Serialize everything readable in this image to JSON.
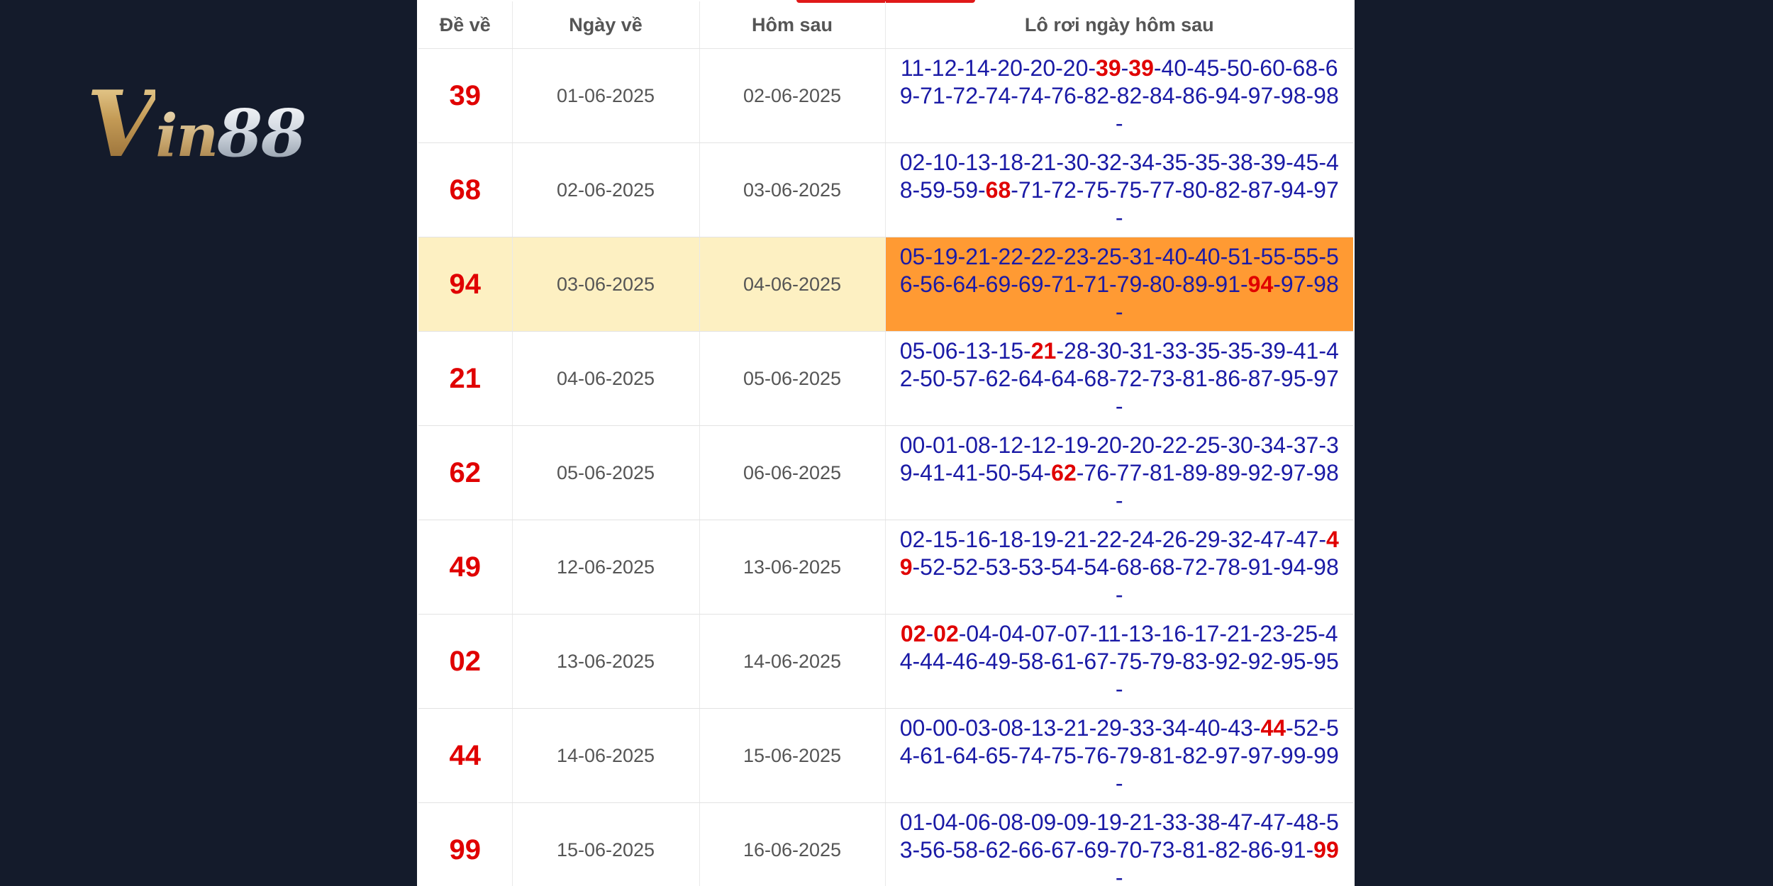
{
  "brand": {
    "logo_v": "V",
    "logo_in": "in",
    "logo_num": "88"
  },
  "table": {
    "headers": [
      "Đề về",
      "Ngày về",
      "Hôm sau",
      "Lô rơi ngày hôm sau"
    ],
    "rows": [
      {
        "de": "39",
        "ngay_ve": "01-06-2025",
        "hom_sau": "02-06-2025",
        "lo": "11-12-14-20-20-20-39-39-40-45-50-60-68-69-71-72-74-74-76-82-82-84-86-94-97-98-98-",
        "highlight": false
      },
      {
        "de": "68",
        "ngay_ve": "02-06-2025",
        "hom_sau": "03-06-2025",
        "lo": "02-10-13-18-21-30-32-34-35-35-38-39-45-48-59-59-68-71-72-75-75-77-80-82-87-94-97-",
        "highlight": false
      },
      {
        "de": "94",
        "ngay_ve": "03-06-2025",
        "hom_sau": "04-06-2025",
        "lo": "05-19-21-22-22-23-25-31-40-40-51-55-55-56-56-64-69-69-71-71-79-80-89-91-94-97-98-",
        "highlight": true
      },
      {
        "de": "21",
        "ngay_ve": "04-06-2025",
        "hom_sau": "05-06-2025",
        "lo": "05-06-13-15-21-28-30-31-33-35-35-39-41-42-50-57-62-64-64-68-72-73-81-86-87-95-97-",
        "highlight": false
      },
      {
        "de": "62",
        "ngay_ve": "05-06-2025",
        "hom_sau": "06-06-2025",
        "lo": "00-01-08-12-12-19-20-20-22-25-30-34-37-39-41-41-50-54-62-76-77-81-89-89-92-97-98-",
        "highlight": false
      },
      {
        "de": "49",
        "ngay_ve": "12-06-2025",
        "hom_sau": "13-06-2025",
        "lo": "02-15-16-18-19-21-22-24-26-29-32-47-47-49-52-52-53-53-54-54-68-68-72-78-91-94-98-",
        "highlight": false
      },
      {
        "de": "02",
        "ngay_ve": "13-06-2025",
        "hom_sau": "14-06-2025",
        "lo": "02-02-04-04-07-07-11-13-16-17-21-23-25-44-44-46-49-58-61-67-75-79-83-92-92-95-95-",
        "highlight": false
      },
      {
        "de": "44",
        "ngay_ve": "14-06-2025",
        "hom_sau": "15-06-2025",
        "lo": "00-00-03-08-13-21-29-33-34-40-43-44-52-54-61-64-65-74-75-76-79-81-82-97-97-99-99-",
        "highlight": false
      },
      {
        "de": "99",
        "ngay_ve": "15-06-2025",
        "hom_sau": "16-06-2025",
        "lo": "01-04-06-08-09-09-19-21-33-38-47-47-48-53-56-58-62-66-67-69-70-73-81-82-86-91-99-",
        "highlight": false
      }
    ]
  },
  "colors": {
    "page_bg": "#141b2b",
    "red": "#e00000",
    "blue": "#1a1aa6",
    "highlight_row": "#fdf0c2",
    "highlight_cell": "#ff9a33"
  }
}
